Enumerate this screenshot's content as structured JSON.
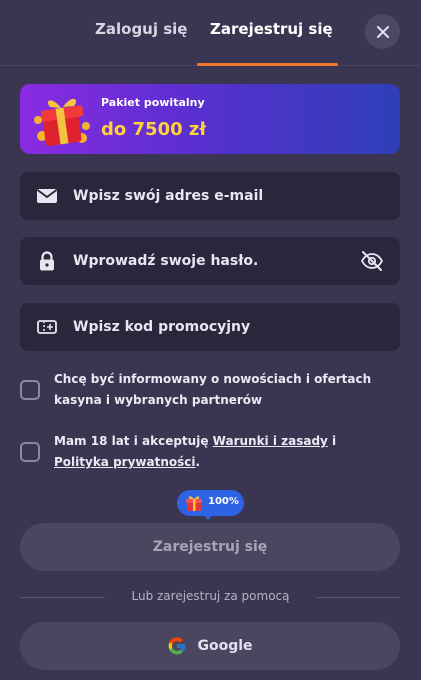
{
  "tabs": {
    "login_label": "Zaloguj się",
    "register_label": "Zarejestruj się"
  },
  "banner": {
    "title": "Pakiet powitalny",
    "amount": "do 7500 zł"
  },
  "form": {
    "email_placeholder": "Wpisz swój adres e-mail",
    "password_placeholder": "Wprowadź swoje hasło.",
    "promo_placeholder": "Wpisz kod promocyjny"
  },
  "consents": {
    "newsletter_text": "Chcę być informowany o nowościach i ofertach kasyna i wybranych partnerów",
    "age_prefix": "Mam 18 lat i akceptuję ",
    "terms_link": "Warunki i zasady",
    "age_middle": " i ",
    "privacy_link": "Polityka prywatności",
    "age_suffix": "."
  },
  "progress_badge": {
    "label": "100%",
    "value": 100
  },
  "submit_label": "Zarejestruj się",
  "alt_divider": "Lub zarejestruj za pomocą",
  "google_label": "Google",
  "colors": {
    "background": "#3a3550",
    "accent_underline": "#f07a2c",
    "banner_amount": "#ffd23a",
    "badge": "#2e63e6",
    "field_bg": "#2b263c"
  }
}
